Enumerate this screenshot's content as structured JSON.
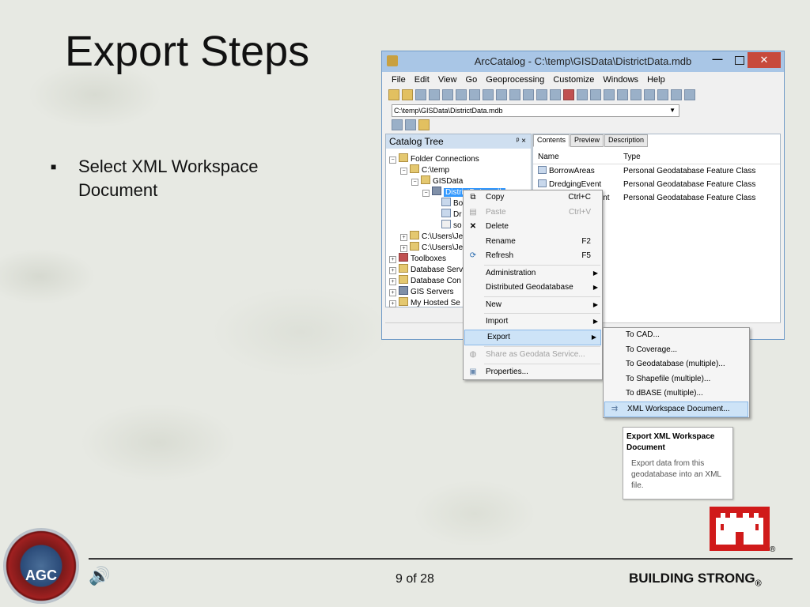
{
  "slide": {
    "title": "Export Steps",
    "bullet": "Select XML Workspace Document",
    "page_number": "9 of 28",
    "footer_brand": "BUILDING STRONG",
    "footer_reg": "®",
    "logo_text": "AGC"
  },
  "window": {
    "title": "ArcCatalog - C:\\temp\\GISData\\DistrictData.mdb",
    "close_label": "✕",
    "minimize_label": "—",
    "menu": [
      "File",
      "Edit",
      "View",
      "Go",
      "Geoprocessing",
      "Customize",
      "Windows",
      "Help"
    ],
    "path": "C:\\temp\\GISData\\DistrictData.mdb"
  },
  "catalog_tree": {
    "header": "Catalog Tree",
    "pin": "1 ×",
    "nodes": [
      "Folder Connections",
      "C:\\temp",
      "GISData",
      "DistrictData.mdb",
      "Bo",
      "Dr",
      "so",
      "C:\\Users\\Je",
      "C:\\Users\\Je",
      "Toolboxes",
      "Database Serv",
      "Database Con",
      "GIS Servers",
      "My Hosted Se"
    ]
  },
  "contents": {
    "tabs": [
      "Contents",
      "Preview",
      "Description"
    ],
    "columns": [
      "Name",
      "Type"
    ],
    "rows": [
      {
        "name": "BorrowAreas",
        "type": "Personal Geodatabase Feature Class"
      },
      {
        "name": "DredgingEvent",
        "type": "Personal Geodatabase Feature Class"
      },
      {
        "name": "int",
        "type": "Personal Geodatabase Feature Class"
      }
    ]
  },
  "context_menu": {
    "copy": "Copy",
    "copy_key": "Ctrl+C",
    "paste": "Paste",
    "paste_key": "Ctrl+V",
    "delete": "Delete",
    "rename": "Rename",
    "rename_key": "F2",
    "refresh": "Refresh",
    "refresh_key": "F5",
    "administration": "Administration",
    "distributed": "Distributed Geodatabase",
    "new": "New",
    "import": "Import",
    "export": "Export",
    "share": "Share as Geodata Service...",
    "properties": "Properties..."
  },
  "export_submenu": {
    "to_cad": "To CAD...",
    "to_coverage": "To Coverage...",
    "to_geodatabase": "To Geodatabase (multiple)...",
    "to_shapefile": "To Shapefile (multiple)...",
    "to_dbase": "To dBASE (multiple)...",
    "xml": "XML Workspace Document..."
  },
  "tooltip": {
    "title": "Export XML Workspace Document",
    "body": "Export data from this geodatabase into an XML file."
  }
}
